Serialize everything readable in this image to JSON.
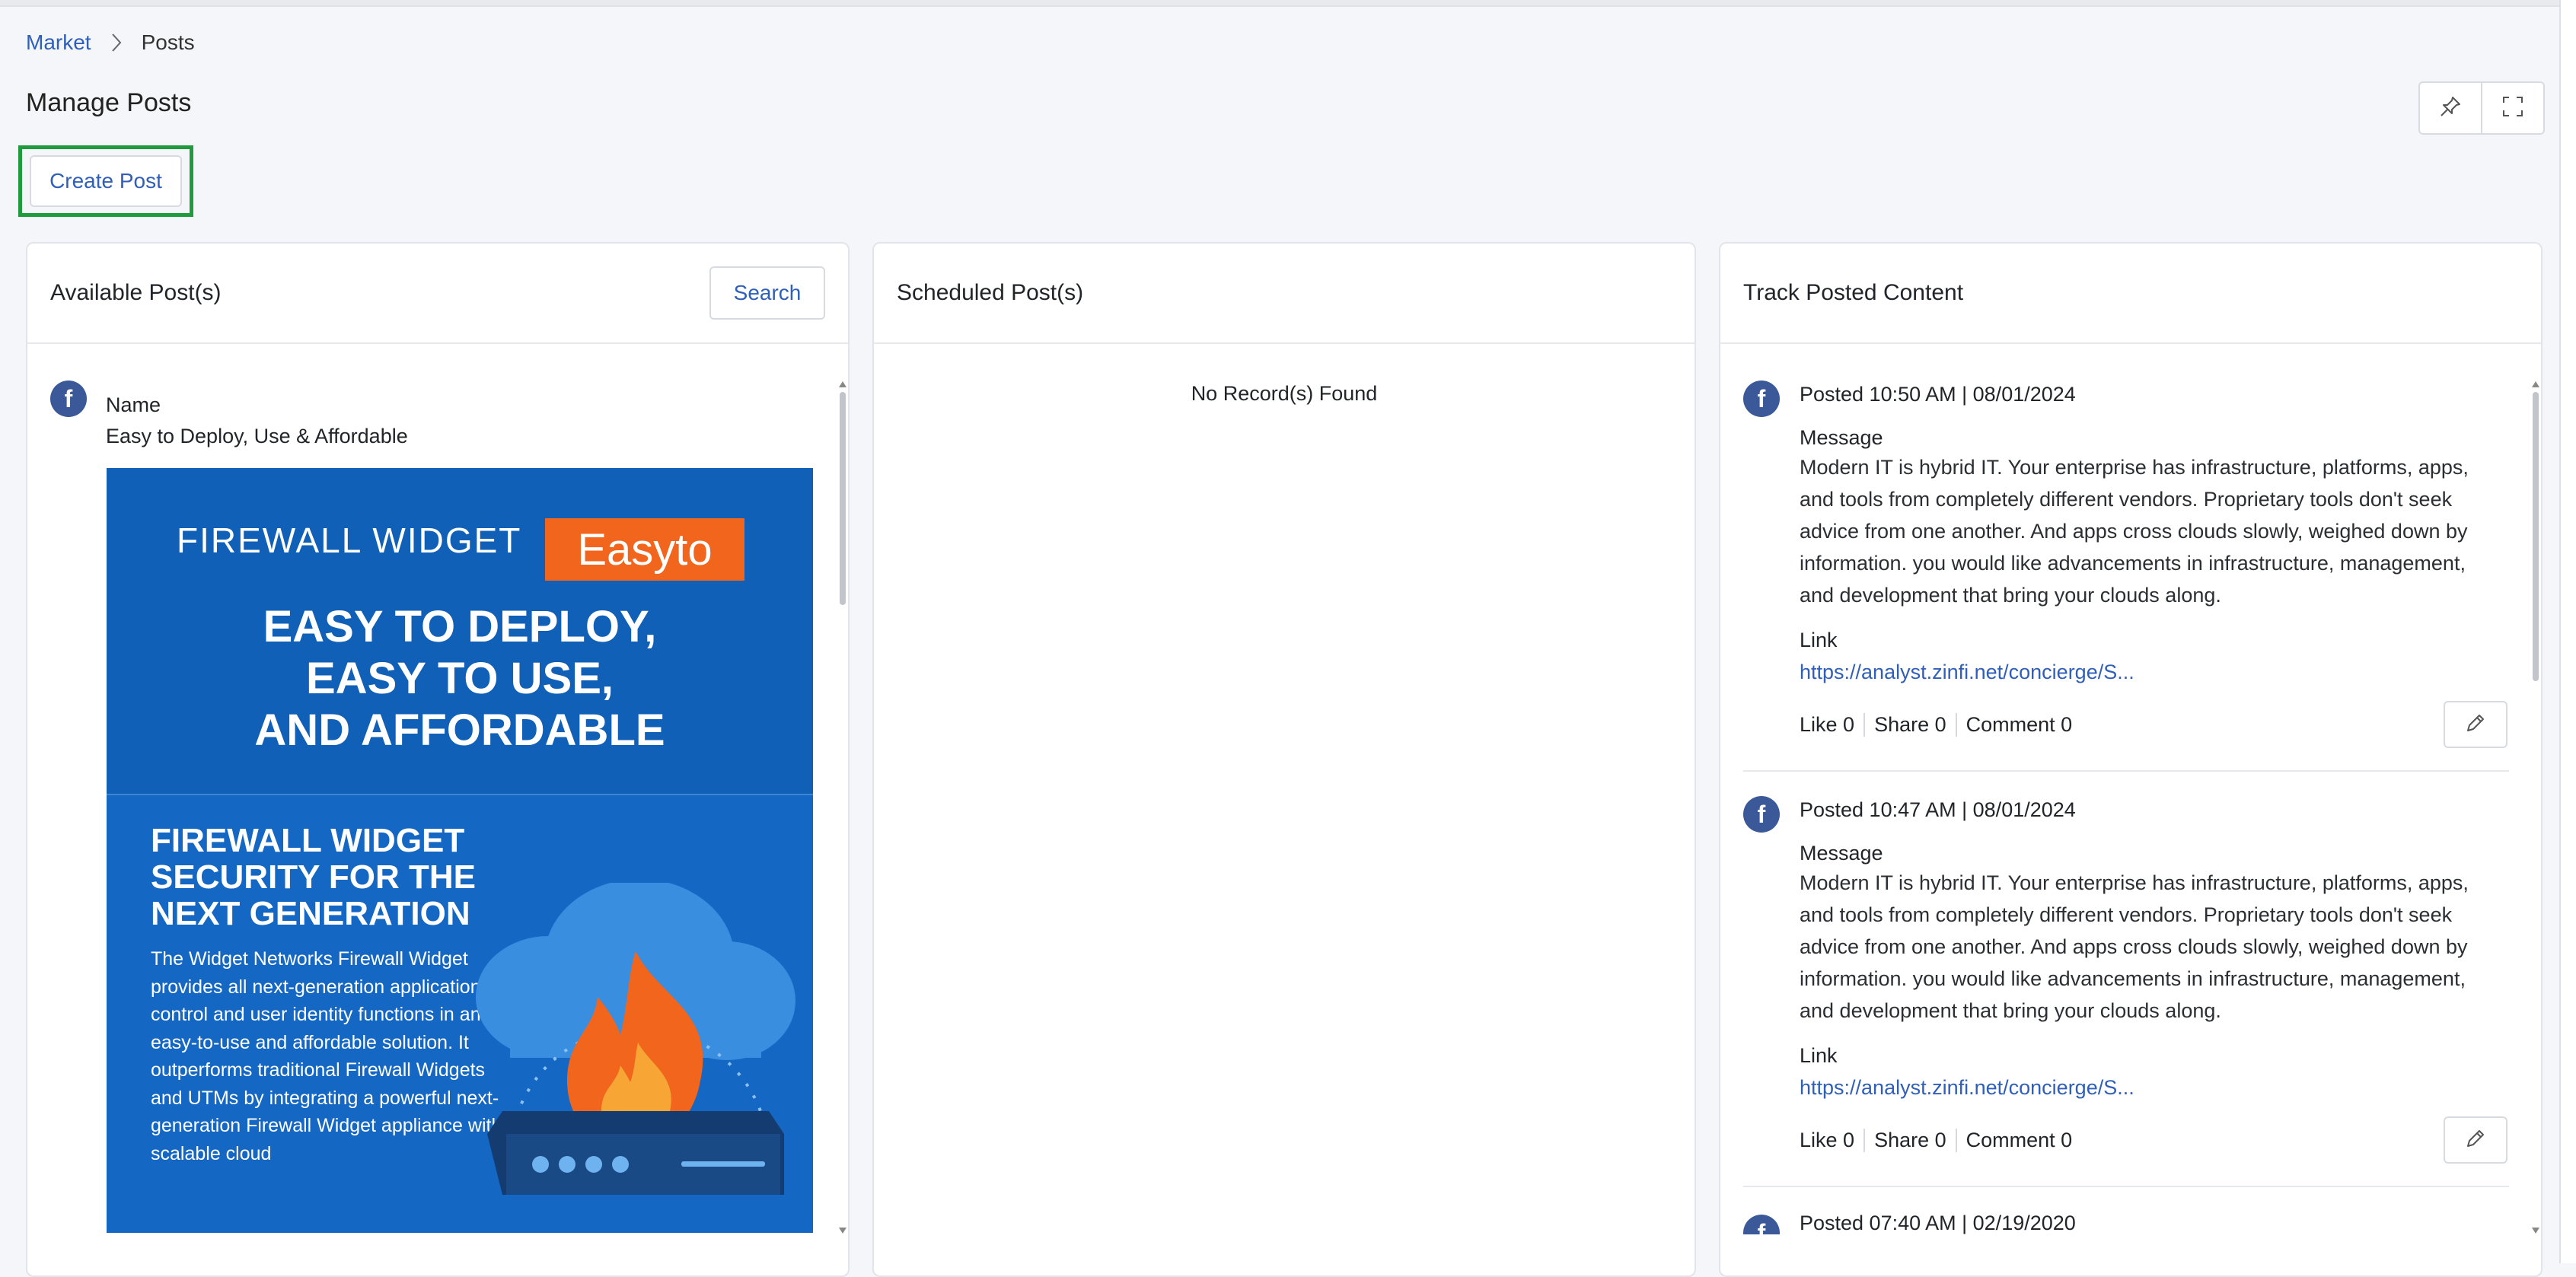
{
  "breadcrumb": {
    "market": "Market",
    "posts": "Posts"
  },
  "page": {
    "title": "Manage Posts",
    "create_button": "Create Post"
  },
  "toolbar": {
    "pin_icon": "pin-icon",
    "fullscreen_icon": "expand-icon"
  },
  "available": {
    "title": "Available Post(s)",
    "search": "Search",
    "post": {
      "name_label": "Name",
      "name_value": "Easy to Deploy, Use & Affordable",
      "image": {
        "brand": "FIREWALL WIDGET",
        "badge": "Easyto",
        "headline_1": "EASY TO DEPLOY,",
        "headline_2": "EASY TO USE,",
        "headline_3": "AND AFFORDABLE",
        "sub_1": "FIREWALL WIDGET",
        "sub_2": "SECURITY FOR THE",
        "sub_3": "NEXT GENERATION",
        "body": "The Widget Networks Firewall Widget provides all next-generation application control and user identity functions in an easy-to-use and affordable solution. It outperforms traditional Firewall Widgets and UTMs by integrating a powerful next-generation Firewall Widget appliance with scalable cloud"
      }
    }
  },
  "scheduled": {
    "title": "Scheduled Post(s)",
    "empty": "No Record(s) Found"
  },
  "track": {
    "title": "Track Posted Content",
    "items": [
      {
        "posted": "Posted 10:50 AM | 08/01/2024",
        "message_label": "Message",
        "message": "Modern IT is hybrid IT. Your enterprise has infrastructure, platforms, apps, and tools from completely different vendors. Proprietary tools don't seek advice from one another. And apps cross clouds slowly, weighed down by information. you would like advancements in infrastructure, management, and development that bring your clouds along.",
        "link_label": "Link",
        "link": "https://analyst.zinfi.net/concierge/S...",
        "like": "Like 0",
        "share": "Share 0",
        "comment": "Comment 0"
      },
      {
        "posted": "Posted 10:47 AM | 08/01/2024",
        "message_label": "Message",
        "message": "Modern IT is hybrid IT. Your enterprise has infrastructure, platforms, apps, and tools from completely different vendors. Proprietary tools don't seek advice from one another. And apps cross clouds slowly, weighed down by information. you would like advancements in infrastructure, management, and development that bring your clouds along.",
        "link_label": "Link",
        "link": "https://analyst.zinfi.net/concierge/S...",
        "like": "Like 0",
        "share": "Share 0",
        "comment": "Comment 0"
      },
      {
        "posted": "Posted 07:40 AM | 02/19/2020"
      }
    ]
  },
  "colors": {
    "accent": "#2f5fb8",
    "facebook": "#3b5998",
    "highlight": "#1f9b3e",
    "promo_blue": "#1467c3",
    "promo_orange": "#f2651c"
  }
}
